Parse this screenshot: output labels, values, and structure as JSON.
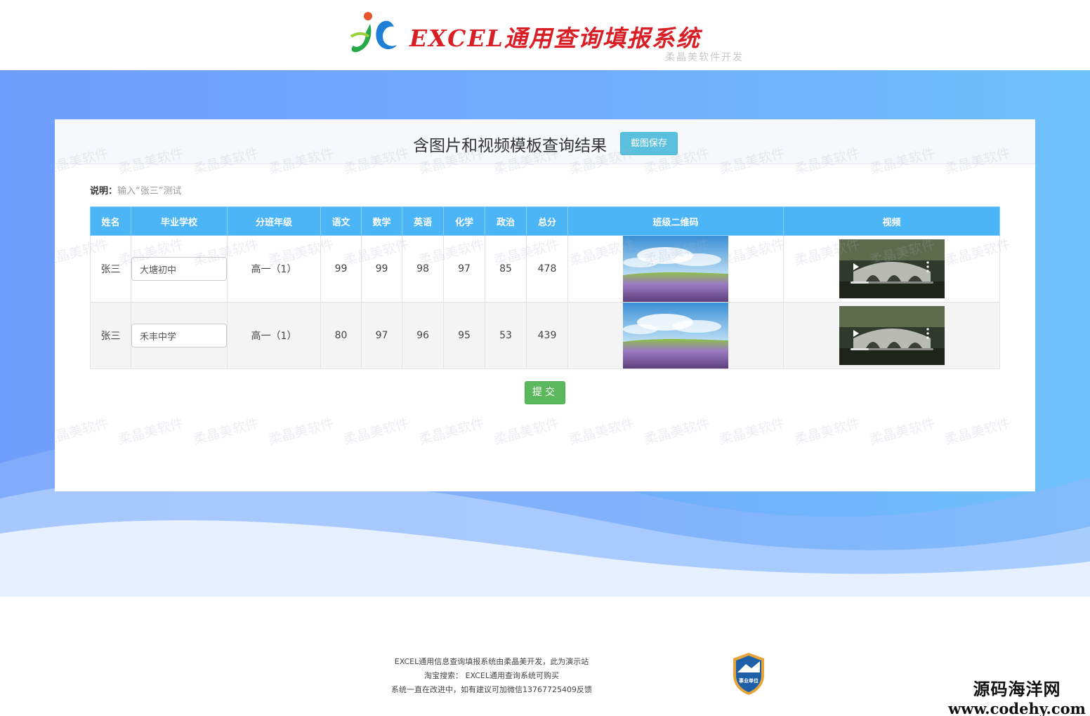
{
  "header": {
    "title": "EXCEL通用查询填报系统",
    "subtitle": "柔晶美软件开发"
  },
  "card": {
    "title": "含图片和视频模板查询结果",
    "save_button": "截图保存",
    "note_label": "说明：",
    "note_text": "输入“张三”测试",
    "submit_button": "提交",
    "watermark": "柔晶美软件"
  },
  "table": {
    "headers": [
      "姓名",
      "毕业学校",
      "分班年级",
      "语文",
      "数学",
      "英语",
      "化学",
      "政治",
      "总分",
      "班级二维码",
      "视频"
    ],
    "rows": [
      {
        "name": "张三",
        "school": "大塘初中",
        "grade": "高一（1）",
        "chinese": "99",
        "math": "99",
        "english": "98",
        "chemistry": "97",
        "politics": "85",
        "total": "478"
      },
      {
        "name": "张三",
        "school": "禾丰中学",
        "grade": "高一（1）",
        "chinese": "80",
        "math": "97",
        "english": "96",
        "chemistry": "95",
        "politics": "53",
        "total": "439"
      }
    ]
  },
  "footer": {
    "line1": "EXCEL通用信息查询填报系统由柔晶美开发，此为演示站",
    "line2": "淘宝搜索： EXCEL通用查询系统可购买",
    "line3": "系统一直在改进中，如有建议可加微信13767725409反馈",
    "badge_text": "事业单位",
    "corner_cn": "源码海洋网",
    "corner_en": "www.codehy.com"
  },
  "colors": {
    "title_red": "#d91f26",
    "header_blue": "#4cb5f5",
    "save_btn": "#5bc0de",
    "submit_btn": "#5cb85c"
  },
  "icons": [
    "logo-jc",
    "play-icon",
    "more-icon",
    "institution-badge-icon"
  ]
}
